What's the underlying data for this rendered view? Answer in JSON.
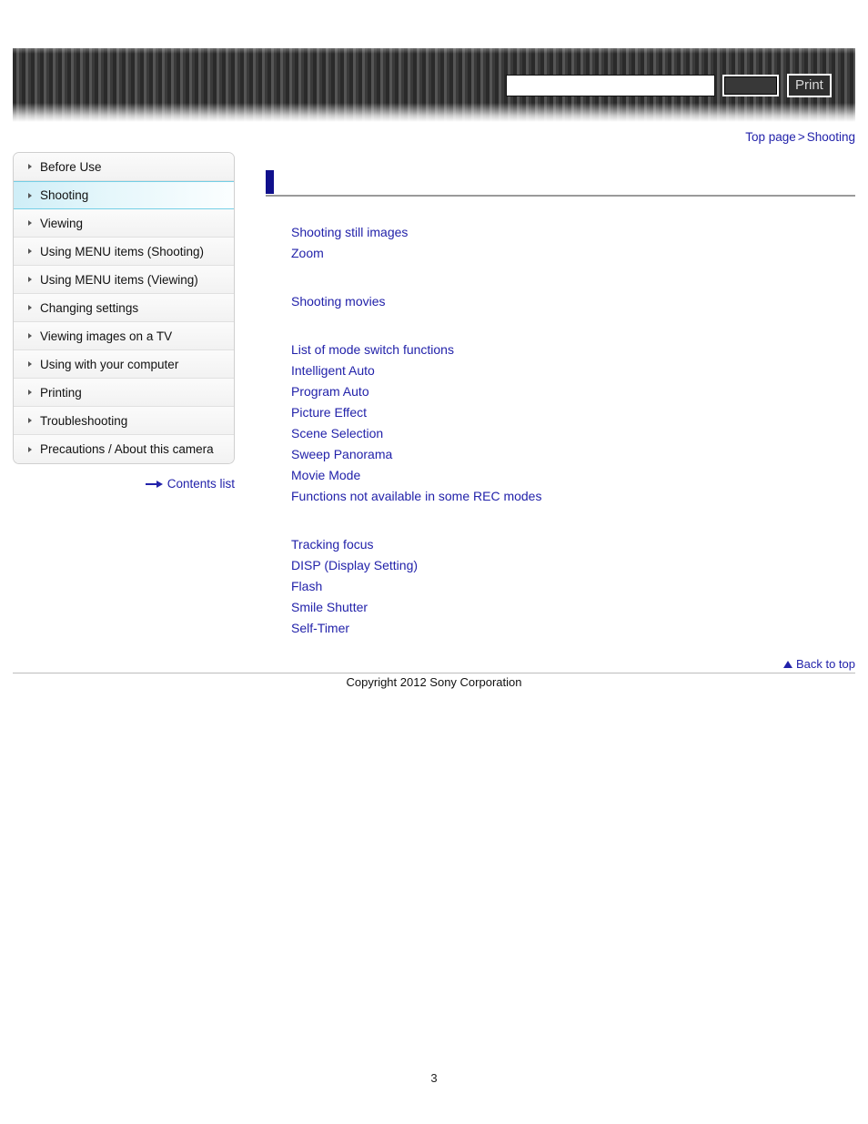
{
  "header": {
    "search": {
      "value": "",
      "placeholder": ""
    },
    "search_button_label": "",
    "print_button_label": "Print"
  },
  "breadcrumb": {
    "top_label": "Top page",
    "separator": ">",
    "current_label": "Shooting"
  },
  "sidebar": {
    "items": [
      {
        "label": "Before Use",
        "selected": false
      },
      {
        "label": "Shooting",
        "selected": true
      },
      {
        "label": "Viewing",
        "selected": false
      },
      {
        "label": "Using MENU items (Shooting)",
        "selected": false
      },
      {
        "label": "Using MENU items (Viewing)",
        "selected": false
      },
      {
        "label": "Changing settings",
        "selected": false
      },
      {
        "label": "Viewing images on a TV",
        "selected": false
      },
      {
        "label": "Using with your computer",
        "selected": false
      },
      {
        "label": "Printing",
        "selected": false
      },
      {
        "label": "Troubleshooting",
        "selected": false
      },
      {
        "label": "Precautions / About this camera",
        "selected": false
      }
    ],
    "contents_list_label": "Contents list"
  },
  "main": {
    "page_title": "",
    "groups": [
      {
        "heading": "",
        "links": [
          "Shooting still images",
          "Zoom"
        ]
      },
      {
        "heading": "",
        "links": [
          "Shooting movies"
        ]
      },
      {
        "heading": "",
        "links": [
          "List of mode switch functions",
          "Intelligent Auto",
          "Program Auto",
          "Picture Effect",
          "Scene Selection",
          "Sweep Panorama",
          "Movie Mode",
          "Functions not available in some REC modes"
        ]
      },
      {
        "heading": "",
        "links": [
          "Tracking focus",
          "DISP (Display Setting)",
          "Flash",
          "Smile Shutter",
          "Self-Timer"
        ]
      }
    ]
  },
  "footer": {
    "back_to_top_label": "Back to top",
    "copyright": "Copyright 2012 Sony Corporation",
    "page_number": "3"
  },
  "colors": {
    "link_blue": "#2222aa",
    "heading_blue": "#10108c",
    "selected_cyan": "#74cfe6",
    "banner_dark": "#2a2a2a"
  }
}
